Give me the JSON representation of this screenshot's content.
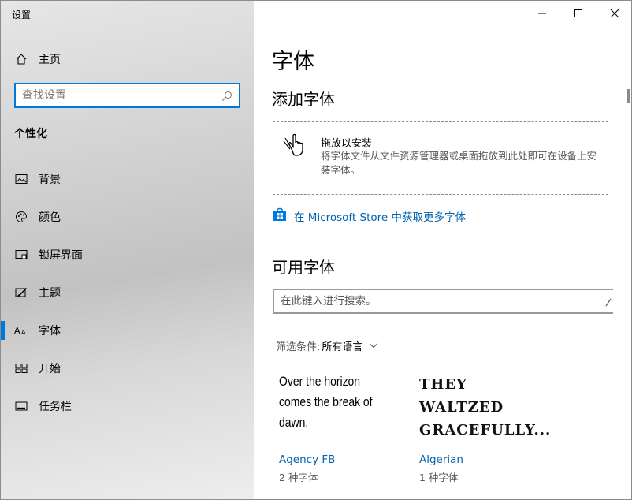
{
  "app": {
    "title": "设置"
  },
  "window_controls": {
    "minimize": "—",
    "maximize": "☐",
    "close": "✕"
  },
  "sidebar": {
    "home": {
      "label": "主页",
      "icon": "home-icon"
    },
    "search": {
      "placeholder": "查找设置"
    },
    "section": "个性化",
    "items": [
      {
        "label": "背景",
        "icon": "picture-icon"
      },
      {
        "label": "颜色",
        "icon": "palette-icon"
      },
      {
        "label": "锁屏界面",
        "icon": "lock-screen-icon"
      },
      {
        "label": "主题",
        "icon": "theme-icon"
      },
      {
        "label": "字体",
        "icon": "font-icon",
        "selected": true
      },
      {
        "label": "开始",
        "icon": "start-icon"
      },
      {
        "label": "任务栏",
        "icon": "taskbar-icon"
      }
    ]
  },
  "main": {
    "title": "字体",
    "add_fonts": {
      "heading": "添加字体",
      "drop_title": "拖放以安装",
      "drop_desc": "将字体文件从文件资源管理器或桌面拖放到此处即可在设备上安装字体。"
    },
    "store_link": "在 Microsoft Store 中获取更多字体",
    "available": {
      "heading": "可用字体",
      "search_placeholder": "在此键入进行搜索。",
      "filter_label": "筛选条件:",
      "filter_value": "所有语言"
    },
    "fonts": [
      {
        "preview": "Over the horizon comes the break of dawn.",
        "name": "Agency FB",
        "count": "2 种字体"
      },
      {
        "preview": "THEY WALTZED GRACEFULLY...",
        "name": "Algerian",
        "count": "1 种字体"
      }
    ]
  },
  "colors": {
    "accent": "#0078d7",
    "link": "#0063b1"
  }
}
